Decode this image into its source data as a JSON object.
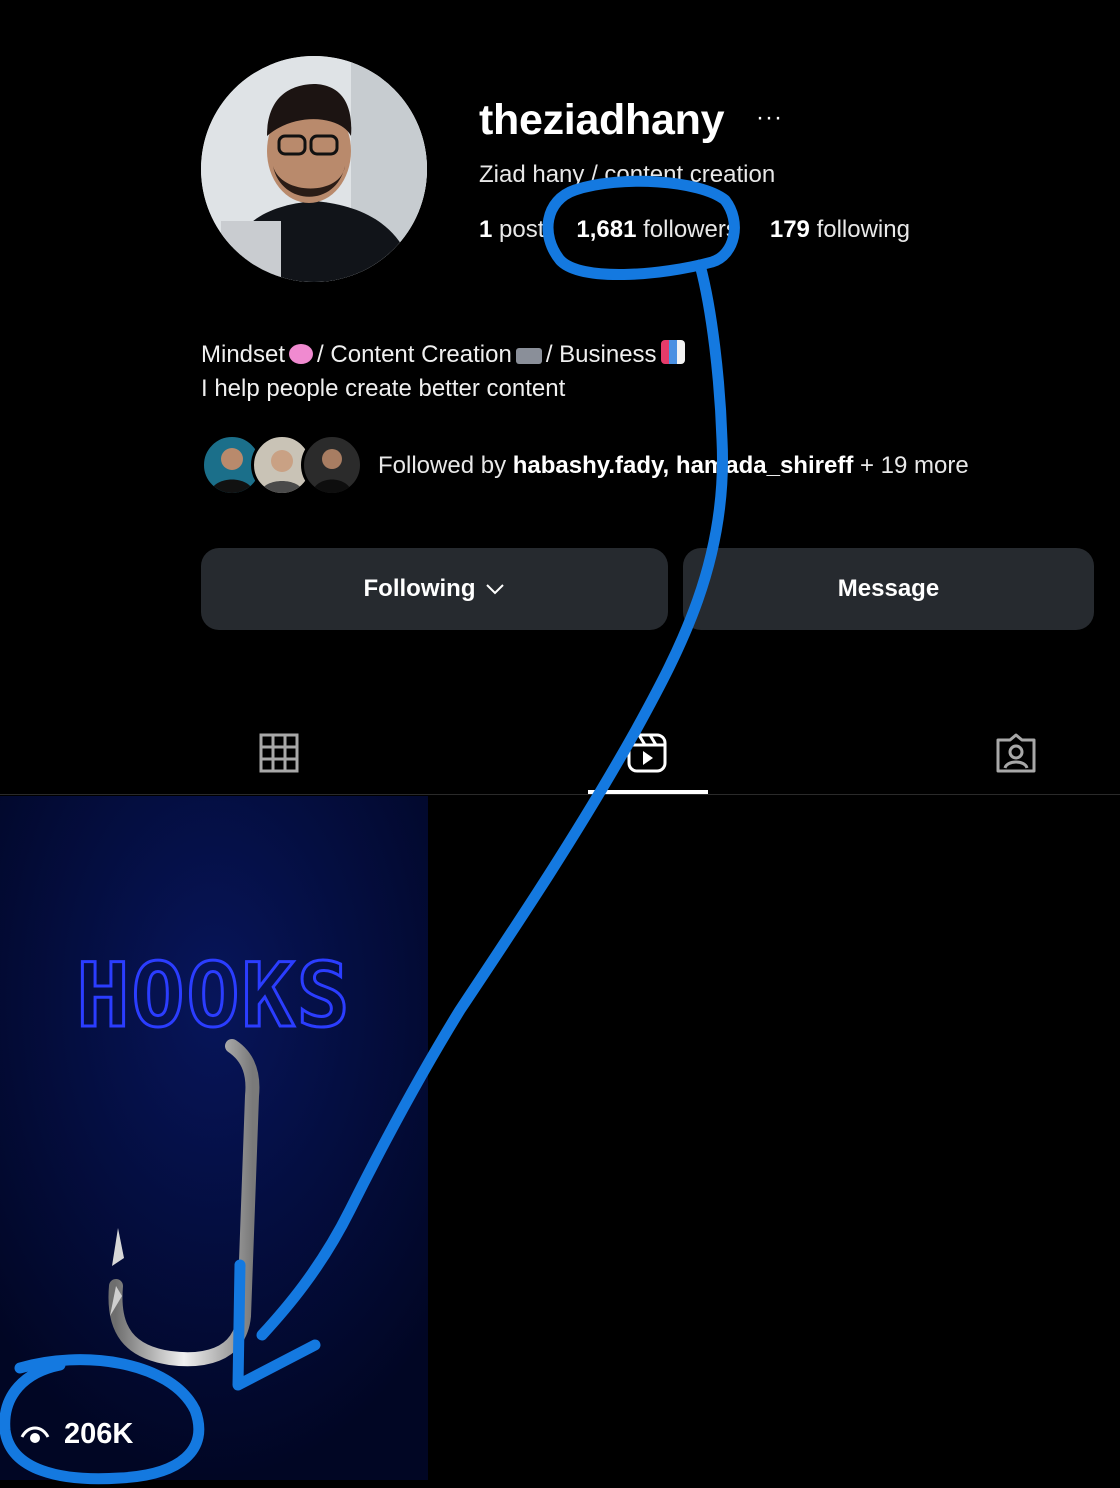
{
  "profile": {
    "username": "theziadhany",
    "full_name": "Ziad hany / content creation",
    "stats": {
      "posts_count": "1",
      "posts_label": "post",
      "followers_count": "1,681",
      "followers_label": "followers",
      "following_count": "179",
      "following_label": "following"
    },
    "bio_line1_part1": "Mindset",
    "bio_line1_part2": "/ Content Creation",
    "bio_line1_part3": "/ Business",
    "bio_line2": "I help people create better content",
    "followed_by_prefix": "Followed by",
    "followed_by_user1": "habashy.fady,",
    "followed_by_user2": "hamada_shireff",
    "followed_by_suffix": "+ 19 more"
  },
  "actions": {
    "following_label": "Following",
    "message_label": "Message"
  },
  "tabs": [
    {
      "name": "posts",
      "icon": "grid-icon",
      "active": false
    },
    {
      "name": "reels",
      "icon": "reels-icon",
      "active": true
    },
    {
      "name": "tagged",
      "icon": "tagged-icon",
      "active": false
    }
  ],
  "reels": [
    {
      "title_art": "HOOKS",
      "views": "206K",
      "icon": "eye-icon"
    }
  ],
  "colors": {
    "background": "#000000",
    "button_bg": "#262a2f",
    "annotation": "#1479e0",
    "reel_bg": "#020a2e",
    "hooks_outline": "#2b3dff"
  }
}
